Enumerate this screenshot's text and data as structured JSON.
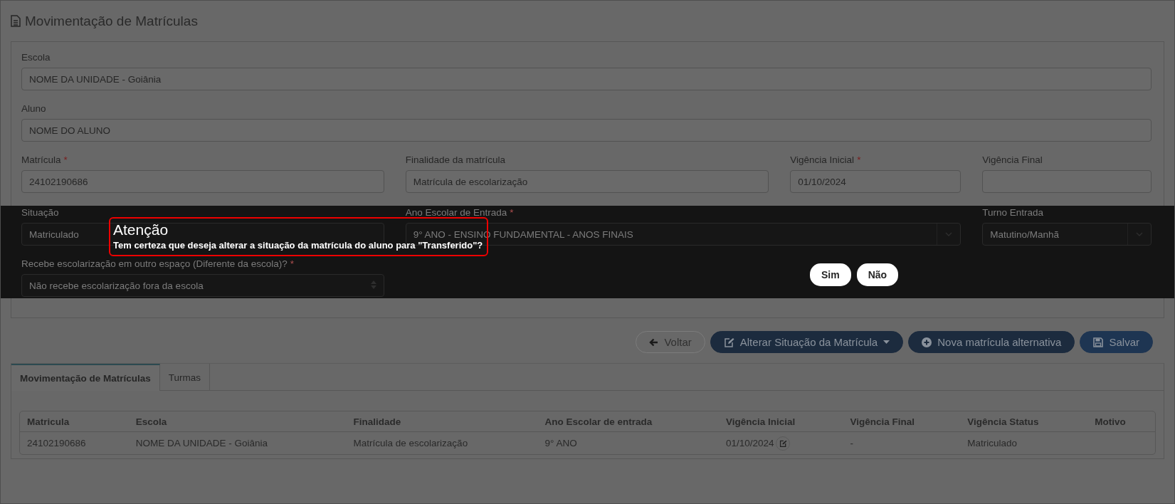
{
  "page": {
    "title": "Movimentação de Matrículas"
  },
  "form": {
    "rows": [
      [
        {
          "label": "Escola",
          "kind": "input",
          "value": "NOME DA UNIDADE - Goiânia"
        }
      ],
      [
        {
          "label": "Aluno",
          "kind": "input",
          "value": "NOME DO ALUNO"
        }
      ],
      [
        {
          "label": "Matrícula",
          "required_mark": "*",
          "kind": "input",
          "value": "24102190686"
        },
        {
          "label": "Finalidade da matrícula",
          "kind": "input",
          "value": "Matrícula de escolarização"
        },
        {
          "label": "Vigência Inicial",
          "required_mark": "*",
          "kind": "input",
          "value": "01/10/2024"
        },
        {
          "label": "Vigência Final",
          "kind": "input"
        }
      ]
    ],
    "covered_rows": [
      [
        {
          "label": "Situação",
          "kind": "input",
          "value": "Matriculado"
        },
        {
          "label": "Ano Escolar de Entrada",
          "required_mark": "*",
          "kind": "select",
          "value": "9° ANO - ENSINO FUNDAMENTAL - ANOS FINAIS"
        },
        {
          "label": "Turno Entrada",
          "kind": "select",
          "value": "Matutino/Manhã"
        }
      ],
      [
        {
          "label": "Recebe escolarização em outro espaço (Diferente da escola)?",
          "required_mark": "*",
          "kind": "native-select",
          "value": "Não recebe escolarização fora da escola"
        }
      ]
    ]
  },
  "dialog": {
    "title": "Atenção",
    "message": "Tem certeza que deseja alterar a situação da matrícula do aluno para \"Transferido\"?",
    "buttons": [
      "Sim",
      "Não"
    ]
  },
  "actions": [
    {
      "kind": "back",
      "label": "Voltar"
    },
    {
      "kind": "status",
      "label": "Alterar Situação da Matrícula"
    },
    {
      "kind": "new",
      "label": "Nova matrícula alternativa"
    },
    {
      "kind": "save",
      "label": "Salvar"
    }
  ],
  "tabs": [
    {
      "label": "Movimentação de Matrículas",
      "selected": true
    },
    {
      "label": "Turmas",
      "selected": false
    }
  ],
  "table": {
    "columns": [
      "Matricula",
      "Escola",
      "Finalidade",
      "Ano Escolar de entrada",
      "Vigência Inicial",
      "Vigência Final",
      "Vigência Status",
      "Motivo"
    ],
    "rows": [
      {
        "cells": [
          {
            "text": "24102190686",
            "editable": false
          },
          {
            "text": "NOME DA UNIDADE - Goiânia",
            "editable": false
          },
          {
            "text": "Matrícula de escolarização",
            "editable": false
          },
          {
            "text": "9° ANO",
            "editable": false
          },
          {
            "text": "01/10/2024",
            "editable": true
          },
          {
            "text": "-",
            "editable": false
          },
          {
            "text": "Matriculado",
            "editable": false
          }
        ]
      }
    ]
  }
}
